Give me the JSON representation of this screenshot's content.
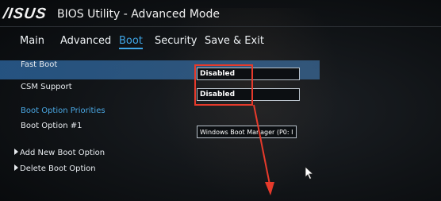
{
  "header": {
    "brand": "/ISUS",
    "title": "BIOS Utility - Advanced Mode"
  },
  "tabs": [
    {
      "label": "Main",
      "active": false
    },
    {
      "label": "Advanced",
      "active": false
    },
    {
      "label": "Boot",
      "active": true
    },
    {
      "label": "Security",
      "active": false
    },
    {
      "label": "Save & Exit",
      "active": false
    }
  ],
  "settings": {
    "fast_boot": {
      "label": "Fast Boot",
      "value": "Disabled"
    },
    "csm_support": {
      "label": "CSM Support",
      "value": "Disabled"
    },
    "boot_option_priorities": {
      "label": "Boot Option Priorities"
    },
    "boot_option_1": {
      "label": "Boot Option #1",
      "value": "Windows Boot Manager (P0: I"
    },
    "add_new_boot_option": {
      "label": "Add New Boot Option"
    },
    "delete_boot_option": {
      "label": "Delete Boot Option"
    }
  },
  "colors": {
    "accent": "#3fa6e6",
    "highlight_row": "#2f6aa0",
    "annotation": "#e63a2b"
  }
}
